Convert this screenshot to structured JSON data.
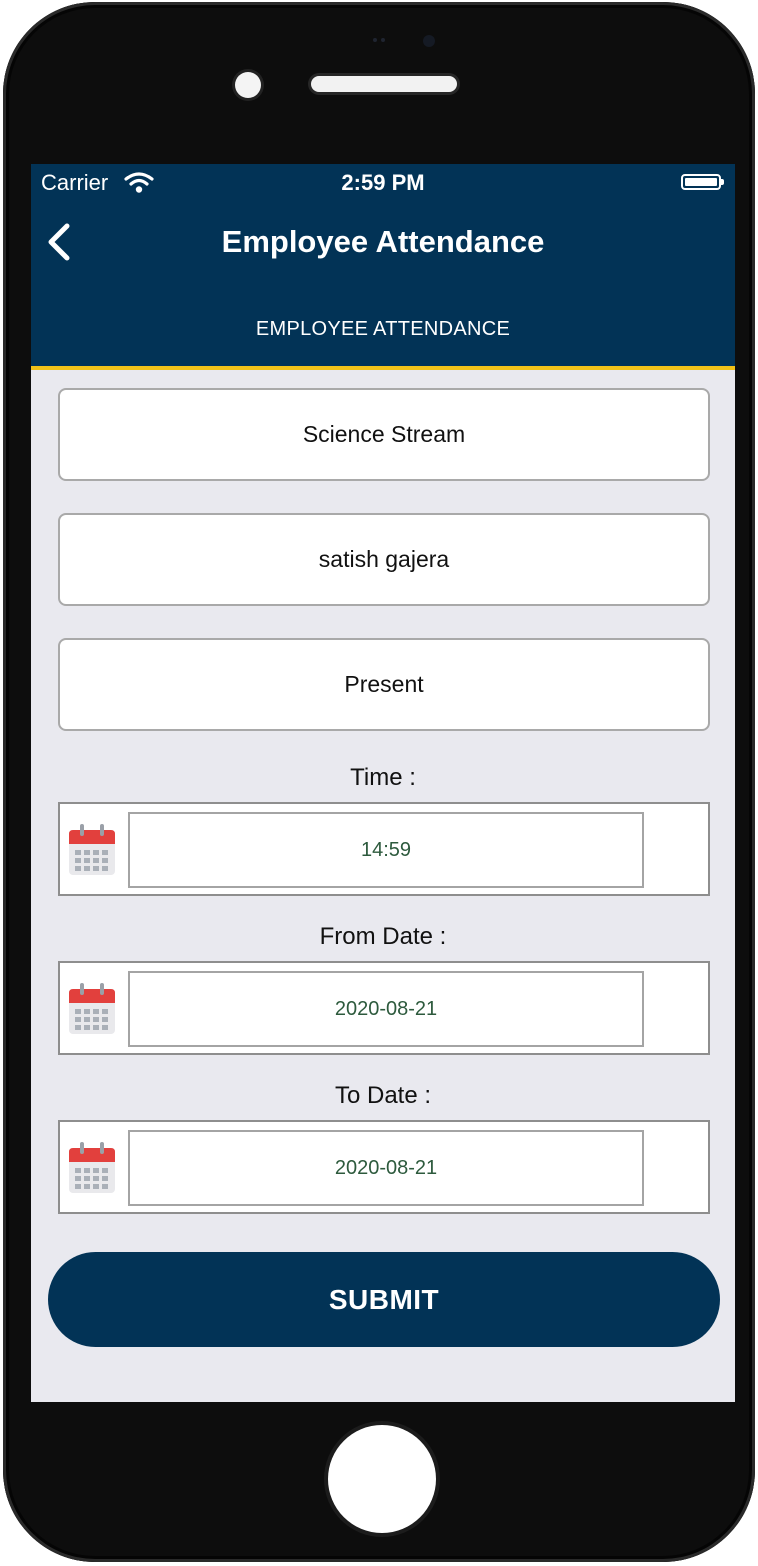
{
  "status_bar": {
    "carrier": "Carrier",
    "time": "2:59 PM"
  },
  "navbar": {
    "title": "Employee Attendance"
  },
  "section": {
    "header": "EMPLOYEE ATTENDANCE"
  },
  "form": {
    "stream": "Science Stream",
    "employee": "satish gajera",
    "status": "Present",
    "time_label": "Time :",
    "time_value": "14:59",
    "from_label": "From Date :",
    "from_value": "2020-08-21",
    "to_label": "To Date :",
    "to_value": "2020-08-21"
  },
  "submit_label": "SUBMIT",
  "colors": {
    "primary": "#023356",
    "accent": "#f2c218",
    "background": "#e9e9ef",
    "date_text": "#2d5a3d",
    "calendar_red": "#e2403d"
  },
  "icons": [
    "back-chevron-icon",
    "wifi-icon",
    "battery-icon",
    "calendar-icon"
  ]
}
